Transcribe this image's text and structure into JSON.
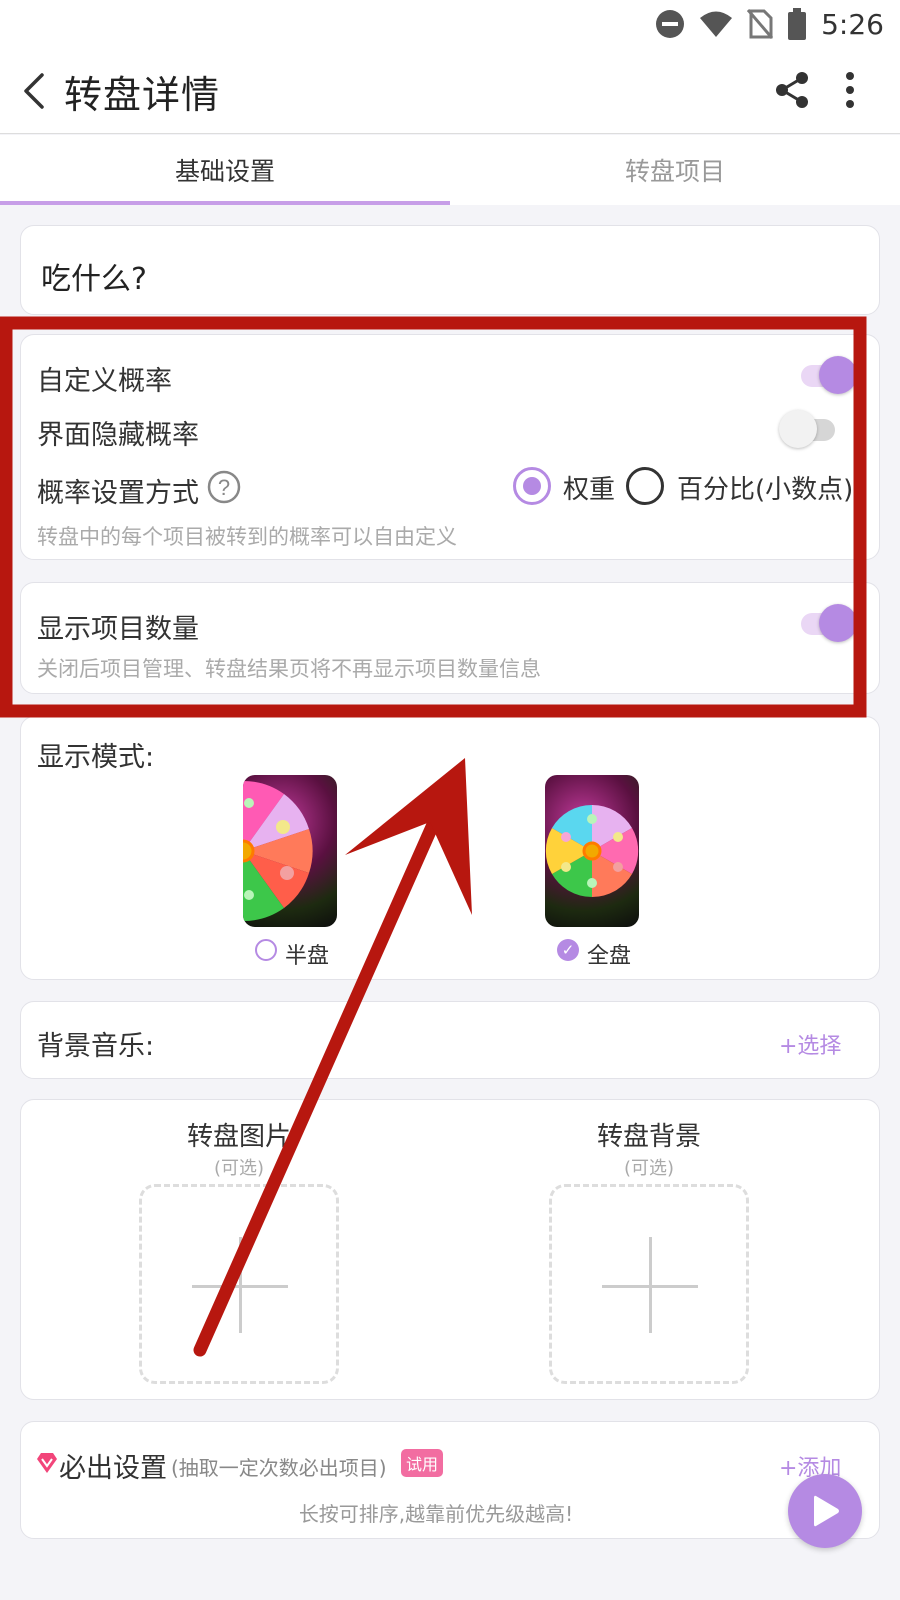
{
  "status_bar": {
    "time": "5:26"
  },
  "app_bar": {
    "title": "转盘详情"
  },
  "tabs": [
    {
      "label": "基础设置"
    },
    {
      "label": "转盘项目"
    }
  ],
  "wheel_name": "吃什么?",
  "probability": {
    "custom_label": "自定义概率",
    "custom_on": true,
    "hide_label": "界面隐藏概率",
    "hide_on": false,
    "method_label": "概率设置方式",
    "option_weight": "权重",
    "option_percent": "百分比(小数点)",
    "selected": "权重",
    "hint": "转盘中的每个项目被转到的概率可以自由定义"
  },
  "show_count": {
    "label": "显示项目数量",
    "on": true,
    "hint": "关闭后项目管理、转盘结果页将不再显示项目数量信息"
  },
  "display_mode": {
    "label": "显示模式:",
    "option_half": "半盘",
    "option_full": "全盘",
    "selected": "全盘"
  },
  "bg_music": {
    "label": "背景音乐:",
    "action": "+选择"
  },
  "images": {
    "wheel_image_title": "转盘图片",
    "wheel_image_sub": "(可选)",
    "wheel_bg_title": "转盘背景",
    "wheel_bg_sub": "(可选)"
  },
  "must_win": {
    "title": "必出设置",
    "subtitle": "(抽取一定次数必出项目)",
    "tag": "试用",
    "action": "+添加",
    "hint": "长按可排序,越靠前优先级越高!"
  },
  "colors": {
    "accent": "#b58ae3",
    "annotation": "#b7170f",
    "trial_tag": "#f26da1"
  }
}
